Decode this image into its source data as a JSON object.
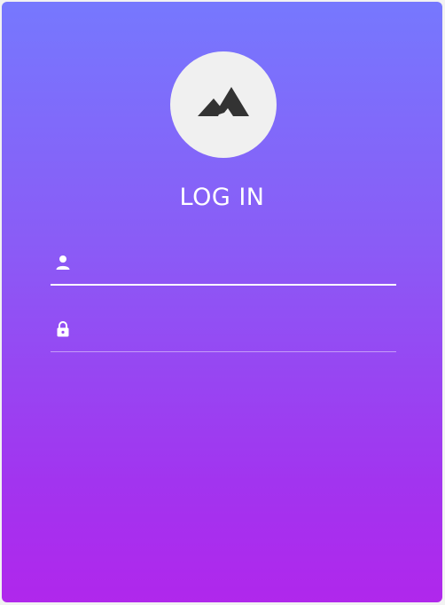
{
  "login": {
    "title": "LOG IN",
    "logo_icon": "mountain-icon",
    "username": {
      "icon": "user-icon",
      "value": "",
      "placeholder": ""
    },
    "password": {
      "icon": "lock-icon",
      "value": "",
      "placeholder": ""
    }
  },
  "colors": {
    "gradient_top": "#7678fe",
    "gradient_bottom": "#b027ec",
    "logo_background": "#f0f0f0",
    "logo_glyph": "#333333",
    "text": "#ffffff"
  }
}
